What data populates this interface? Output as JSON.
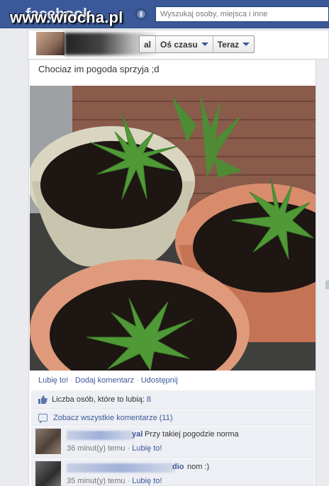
{
  "header": {
    "logo": "facebook",
    "watermark": "www.wiocha.pl",
    "search_placeholder": "Wyszukaj osoby, miejsca i inne"
  },
  "timeline": {
    "name_suffix": "al",
    "nav": [
      {
        "label": "Oś czasu"
      },
      {
        "label": "Teraz"
      }
    ]
  },
  "post": {
    "text": "Chociaz im pogoda sprzyja ;d",
    "actions": {
      "like": "Lubię to!",
      "comment": "Dodaj komentarz",
      "share": "Udostępnij"
    },
    "likes_label": "Liczba osób, które to lubią:",
    "likes_count": "8",
    "view_comments": "Zobacz wszystkie komentarze (11)"
  },
  "comments": [
    {
      "name_suffix": "yal",
      "text": "Przy takiej pogodzie norma",
      "time": "36 minut(y) temu",
      "like": "Lubię to!"
    },
    {
      "name_suffix": "dio",
      "text": "nom :)",
      "time": "35 minut(y) temu",
      "like": "Lubię to!"
    }
  ],
  "colors": {
    "brand_blue": "#3b5998",
    "link_blue": "#3b5998",
    "feed_bg": "#edeff4"
  }
}
